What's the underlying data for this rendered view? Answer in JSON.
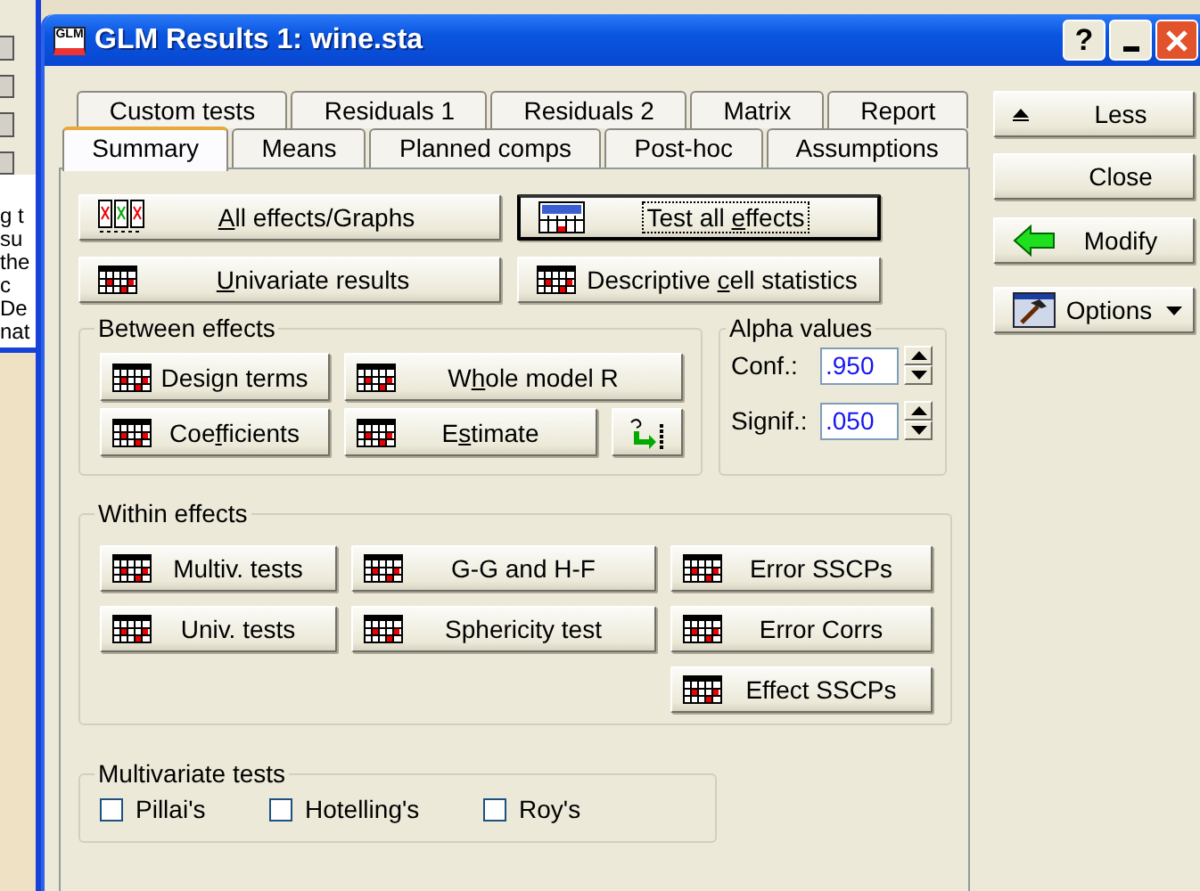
{
  "background_window": {
    "lines": [
      "g t",
      "su",
      "the",
      "c",
      "De",
      "nat"
    ]
  },
  "window": {
    "icon_text": "GLM",
    "title": "GLM Results 1: wine.sta",
    "controls": [
      {
        "kind": "help",
        "label": "?"
      },
      {
        "kind": "minimize"
      },
      {
        "kind": "close"
      }
    ]
  },
  "tab_rows": [
    {
      "tabs": [
        {
          "label": "Custom tests",
          "selected": false
        },
        {
          "label": "Residuals 1",
          "selected": false
        },
        {
          "label": "Residuals 2",
          "selected": false
        },
        {
          "label": "Matrix",
          "selected": false
        },
        {
          "label": "Report",
          "selected": false
        }
      ]
    },
    {
      "tabs": [
        {
          "label": "Summary",
          "selected": true
        },
        {
          "label": "Means",
          "selected": false
        },
        {
          "label": "Planned comps",
          "selected": false
        },
        {
          "label": "Post-hoc",
          "selected": false
        },
        {
          "label": "Assumptions",
          "selected": false
        }
      ]
    }
  ],
  "top_buttons": [
    {
      "key": "A",
      "post": "ll effects/Graphs",
      "default": false
    },
    {
      "pre": "Test all ",
      "key": "e",
      "post": "ffects",
      "default": true
    },
    {
      "key": "U",
      "post": "nivariate results",
      "default": false
    },
    {
      "pre": "Descriptive ",
      "key": "c",
      "post": "ell statistics",
      "default": false
    }
  ],
  "between_effects": {
    "title": "Between effects",
    "rows": [
      {
        "buttons": [
          {
            "kind": "text",
            "pre": "Desi",
            "key": "g",
            "post": "n terms"
          },
          {
            "kind": "text",
            "pre": "W",
            "key": "h",
            "post": "ole model R"
          }
        ]
      },
      {
        "buttons": [
          {
            "kind": "text",
            "pre": "Coe",
            "key": "f",
            "post": "ficients"
          },
          {
            "kind": "text",
            "pre": "E",
            "key": "s",
            "post": "timate"
          },
          {
            "kind": "icon"
          }
        ]
      }
    ]
  },
  "alpha_values": {
    "title": "Alpha values",
    "fields": [
      {
        "label": "Conf.:",
        "value": ".950"
      },
      {
        "label": "Signif.:",
        "value": ".050"
      }
    ]
  },
  "within_effects": {
    "title": "Within effects",
    "columns": [
      {
        "buttons": [
          {
            "label": "Multiv. tests"
          },
          {
            "label": "Univ. tests"
          }
        ]
      },
      {
        "buttons": [
          {
            "label": "G-G and H-F"
          },
          {
            "label": "Sphericity test"
          }
        ]
      },
      {
        "buttons": [
          {
            "label": "Error SSCPs"
          },
          {
            "label": "Error Corrs"
          },
          {
            "label": "Effect SSCPs"
          }
        ]
      }
    ]
  },
  "multivariate_tests": {
    "title": "Multivariate tests",
    "options": [
      {
        "label": "Pillai's",
        "checked": false
      },
      {
        "label": "Hotelling's",
        "checked": false
      },
      {
        "label": "Roy's",
        "checked": false
      }
    ]
  },
  "side_buttons": [
    {
      "label": "Less",
      "menu": false
    },
    {
      "label": "Close",
      "menu": false
    },
    {
      "label": "Modify",
      "menu": false
    },
    {
      "label": "Options",
      "menu": true
    }
  ]
}
